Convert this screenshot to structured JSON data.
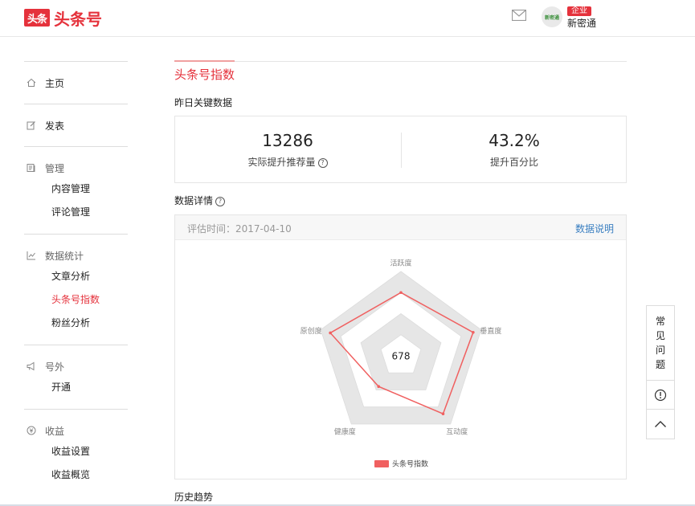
{
  "header": {
    "logo_mark": "头条",
    "logo_text": "头条号",
    "avatar_text": "新密通",
    "badge": "企业",
    "username": "新密通"
  },
  "sidebar": {
    "sections": [
      {
        "icon": "home-icon",
        "label": "主页",
        "items": []
      },
      {
        "icon": "edit-icon",
        "label": "发表",
        "items": []
      },
      {
        "icon": "manage-icon",
        "label": "管理",
        "items": [
          "内容管理",
          "评论管理"
        ]
      },
      {
        "icon": "stats-icon",
        "label": "数据统计",
        "items": [
          "文章分析",
          "头条号指数",
          "粉丝分析"
        ]
      },
      {
        "icon": "megaphone-icon",
        "label": "号外",
        "items": [
          "开通"
        ]
      },
      {
        "icon": "revenue-icon",
        "label": "收益",
        "items": [
          "收益设置",
          "收益概览"
        ]
      }
    ],
    "active_item": "头条号指数"
  },
  "main": {
    "title": "头条号指数",
    "key_data_label": "昨日关键数据",
    "kpis": [
      {
        "value": "13286",
        "label": "实际提升推荐量"
      },
      {
        "value": "43.2%",
        "label": "提升百分比"
      }
    ],
    "detail_label": "数据详情",
    "eval_time": "评估时间：2017-04-10",
    "data_desc": "数据说明",
    "history_label": "历史趋势"
  },
  "chart_data": {
    "type": "radar",
    "axes": [
      "活跃度",
      "垂直度",
      "互动度",
      "健康度",
      "原创度"
    ],
    "series": [
      {
        "name": "头条号指数",
        "values": [
          0.75,
          0.9,
          0.85,
          0.45,
          0.88
        ],
        "color": "#f06060"
      }
    ],
    "center_value": "678",
    "rings": 4
  },
  "float_panel": {
    "faq_chars": [
      "常",
      "见",
      "问",
      "题"
    ]
  }
}
